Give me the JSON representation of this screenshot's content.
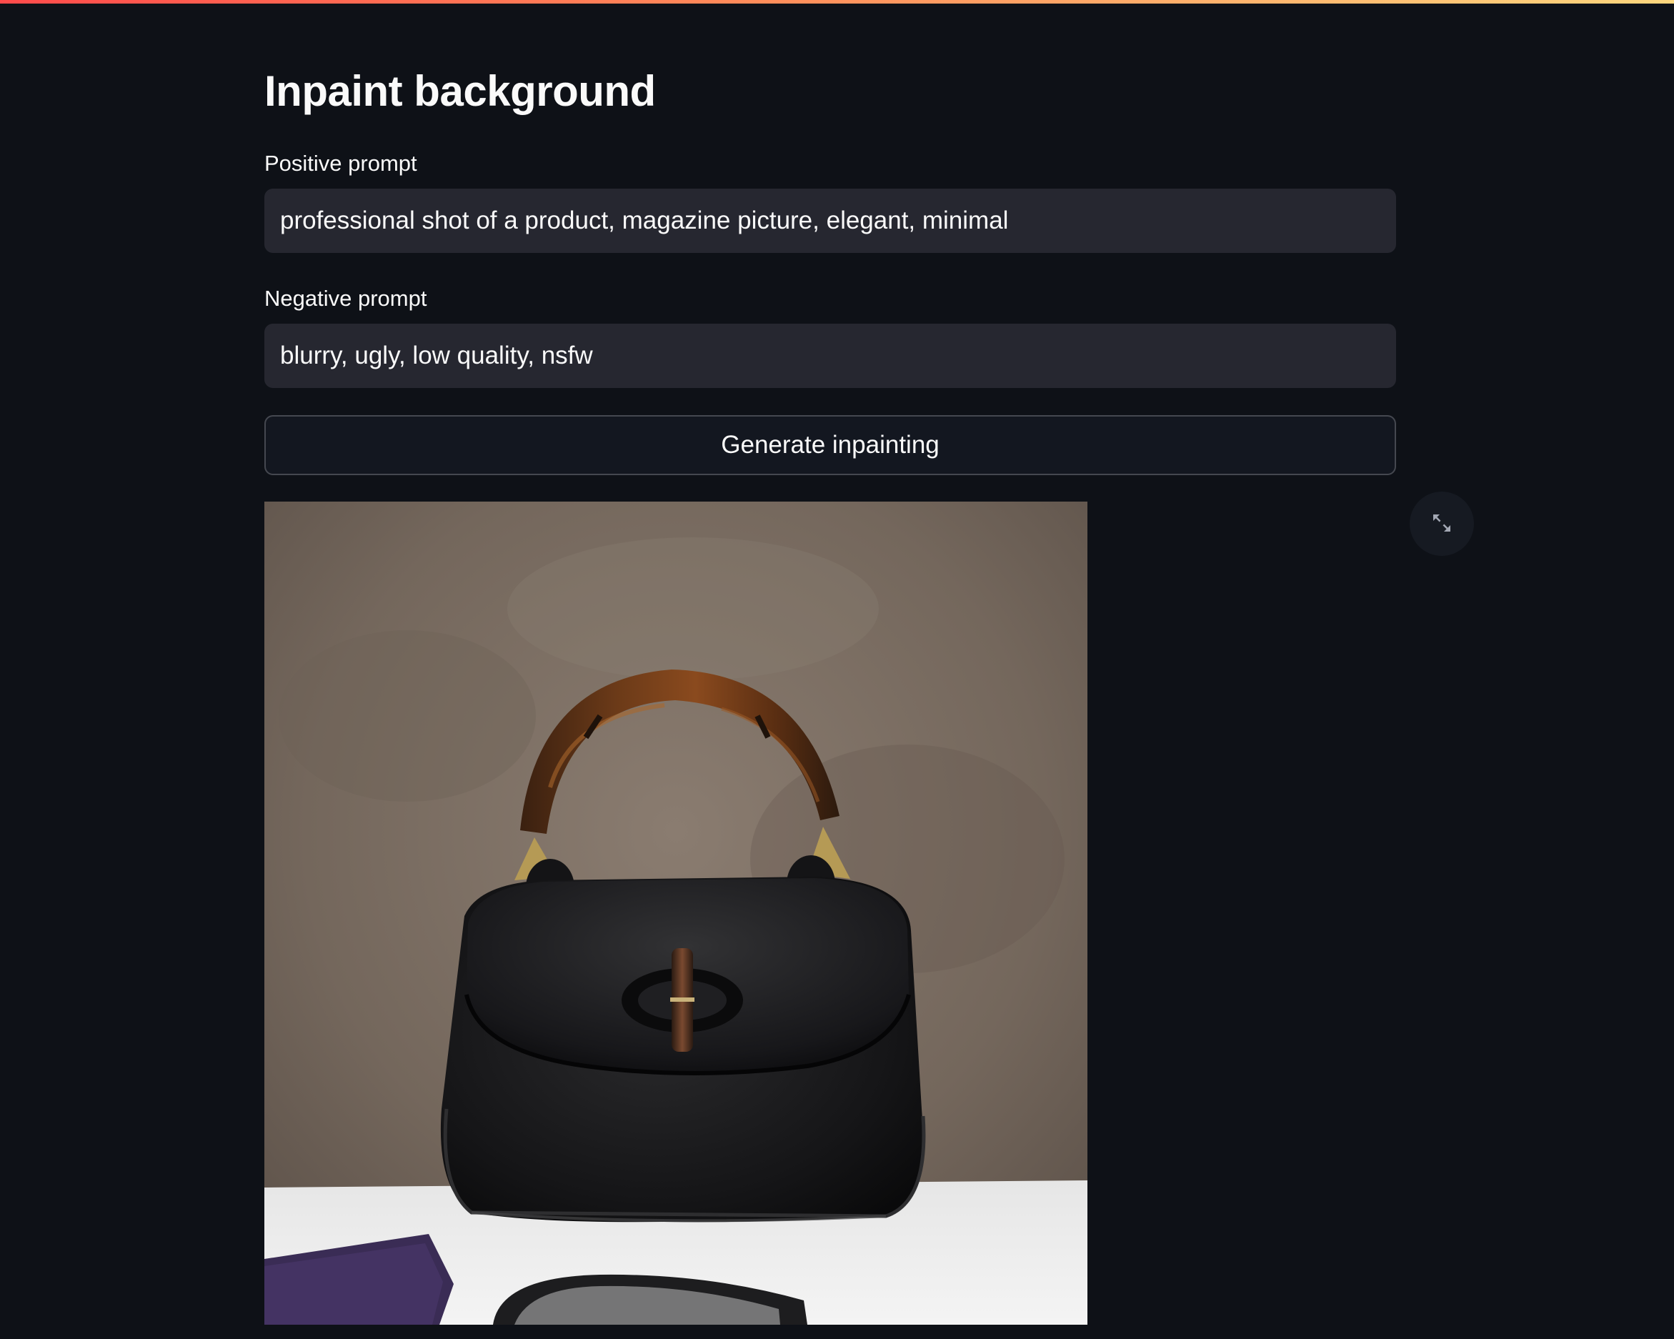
{
  "page": {
    "title": "Inpaint background"
  },
  "positive_prompt": {
    "label": "Positive prompt",
    "value": "professional shot of a product, magazine picture, elegant, minimal"
  },
  "negative_prompt": {
    "label": "Negative prompt",
    "value": "blurry, ugly, low quality, nsfw"
  },
  "generate_button": {
    "label": "Generate inpainting"
  },
  "image": {
    "alt": "",
    "fullscreen_icon": "expand-arrows-icon"
  },
  "colors": {
    "background": "#0e1117",
    "input_background": "#262730",
    "text": "#fafafa",
    "accent_gradient_start": "#ff4b4b",
    "accent_gradient_end": "#fdd77e"
  }
}
